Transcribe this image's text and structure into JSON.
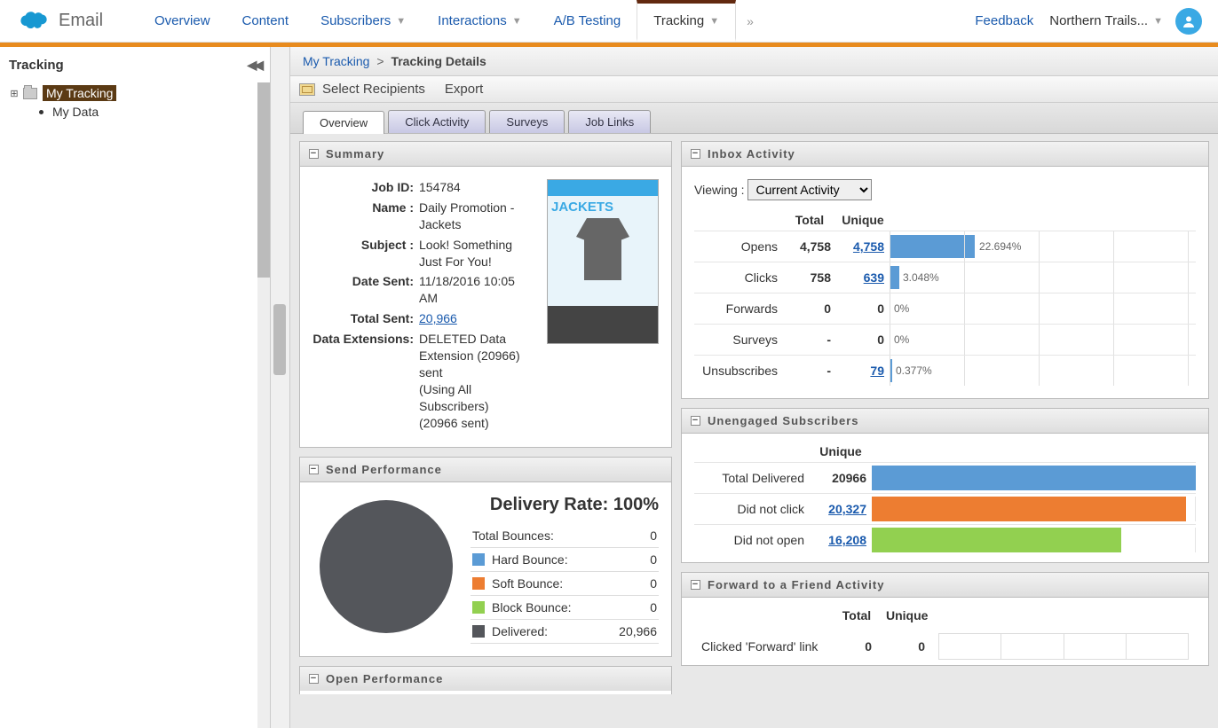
{
  "app_label": "Email",
  "nav": {
    "overview": "Overview",
    "content": "Content",
    "subscribers": "Subscribers",
    "interactions": "Interactions",
    "ab": "A/B Testing",
    "tracking": "Tracking",
    "feedback": "Feedback",
    "account": "Northern Trails..."
  },
  "sidebar": {
    "title": "Tracking",
    "my_tracking": "My Tracking",
    "my_data": "My Data"
  },
  "crumb": {
    "my": "My Tracking",
    "sep": ">",
    "cur": "Tracking Details"
  },
  "toolbar": {
    "select": "Select Recipients",
    "export": "Export"
  },
  "subtabs": {
    "overview": "Overview",
    "click": "Click Activity",
    "surveys": "Surveys",
    "joblinks": "Job Links"
  },
  "panels": {
    "summary": "Summary",
    "sendperf": "Send Performance",
    "openperf": "Open Performance",
    "inbox": "Inbox Activity",
    "unengaged": "Unengaged Subscribers",
    "forward": "Forward to a Friend Activity"
  },
  "summary": {
    "k_jobid": "Job ID:",
    "jobid": "154784",
    "k_name": "Name :",
    "name": "Daily Promotion - Jackets",
    "k_subject": "Subject :",
    "subject": "Look! Something Just For You!",
    "k_date": "Date Sent:",
    "date": "11/18/2016 10:05 AM",
    "k_total": "Total Sent:",
    "total": "20,966",
    "k_de": "Data Extensions:",
    "de": "DELETED Data Extension (20966) sent",
    "de2": "(Using All Subscribers)",
    "de3": "(20966 sent)",
    "preview_title": "JACKETS"
  },
  "sendperf": {
    "delrate": "Delivery Rate: 100%",
    "totalb": "Total Bounces:",
    "totalb_v": "0",
    "hardb": "Hard Bounce:",
    "hardb_v": "0",
    "softb": "Soft Bounce:",
    "softb_v": "0",
    "blockb": "Block Bounce:",
    "blockb_v": "0",
    "deliv": "Delivered:",
    "deliv_v": "20,966"
  },
  "inbox": {
    "viewing": "Viewing :",
    "sel": "Current Activity",
    "h_total": "Total",
    "h_unique": "Unique",
    "r_opens": "Opens",
    "opens_t": "4,758",
    "opens_u": "4,758",
    "opens_p": "22.694%",
    "r_clicks": "Clicks",
    "clicks_t": "758",
    "clicks_u": "639",
    "clicks_p": "3.048%",
    "r_fwd": "Forwards",
    "fwd_t": "0",
    "fwd_u": "0",
    "fwd_p": "0%",
    "r_surv": "Surveys",
    "surv_t": "-",
    "surv_u": "0",
    "surv_p": "0%",
    "r_unsub": "Unsubscribes",
    "unsub_t": "-",
    "unsub_u": "79",
    "unsub_p": "0.377%"
  },
  "unengaged": {
    "h_unique": "Unique",
    "r_td": "Total Delivered",
    "td_v": "20966",
    "r_dnc": "Did not click",
    "dnc_v": "20,327",
    "r_dno": "Did not open",
    "dno_v": "16,208"
  },
  "forward": {
    "h_total": "Total",
    "h_unique": "Unique",
    "r_click": "Clicked 'Forward' link",
    "click_t": "0",
    "click_u": "0"
  },
  "chart_data": [
    {
      "type": "pie",
      "title": "Send Performance",
      "series": [
        {
          "name": "Delivered",
          "value": 20966,
          "color": "#54565b"
        },
        {
          "name": "Hard Bounce",
          "value": 0,
          "color": "#5b9bd5"
        },
        {
          "name": "Soft Bounce",
          "value": 0,
          "color": "#ed7d31"
        },
        {
          "name": "Block Bounce",
          "value": 0,
          "color": "#92d050"
        }
      ],
      "annotation": "Delivery Rate: 100%"
    },
    {
      "type": "bar",
      "title": "Inbox Activity",
      "orientation": "horizontal",
      "categories": [
        "Opens",
        "Clicks",
        "Forwards",
        "Surveys",
        "Unsubscribes"
      ],
      "values_pct": [
        22.694,
        3.048,
        0,
        0,
        0.377
      ],
      "total": [
        4758,
        758,
        0,
        null,
        null
      ],
      "unique": [
        4758,
        639,
        0,
        0,
        79
      ]
    },
    {
      "type": "bar",
      "title": "Unengaged Subscribers",
      "orientation": "horizontal",
      "categories": [
        "Total Delivered",
        "Did not click",
        "Did not open"
      ],
      "values": [
        20966,
        20327,
        16208
      ],
      "colors": [
        "#5b9bd5",
        "#ed7d31",
        "#92d050"
      ],
      "xlim": [
        0,
        21000
      ]
    }
  ]
}
